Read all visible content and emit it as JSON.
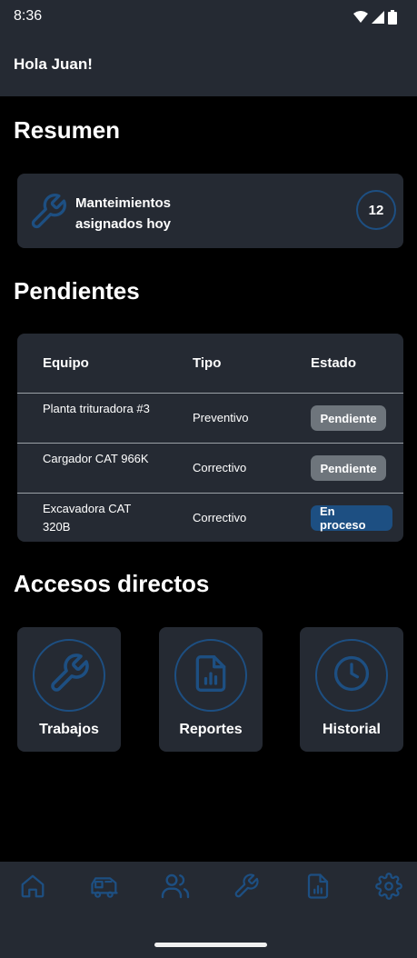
{
  "status_bar": {
    "time": "8:36",
    "icons": [
      "wifi-icon",
      "signal-icon",
      "battery-icon"
    ]
  },
  "app_bar": {
    "greeting": "Hola Juan!"
  },
  "summary": {
    "title": "Resumen",
    "card": {
      "icon": "wrench-icon",
      "label": "Manteimientos asignados hoy",
      "count": "12"
    }
  },
  "pending": {
    "title": "Pendientes",
    "columns": [
      "Equipo",
      "Tipo",
      "Estado"
    ],
    "rows": [
      {
        "equipo": "Planta trituradora #3",
        "tipo": "Preventivo",
        "estado": "Pendiente"
      },
      {
        "equipo": "Cargador CAT 966K",
        "tipo": "Correctivo",
        "estado": "Pendiente"
      },
      {
        "equipo": "Excavadora CAT 320B",
        "tipo": "Correctivo",
        "estado": "En proceso"
      }
    ]
  },
  "shortcuts": {
    "title": "Accesos directos",
    "items": [
      {
        "label": "Trabajos",
        "icon": "wrench-icon"
      },
      {
        "label": "Reportes",
        "icon": "report-file-icon"
      },
      {
        "label": "Historial",
        "icon": "clock-icon"
      }
    ]
  },
  "bottom_nav": {
    "items": [
      "home-icon",
      "truck-icon",
      "users-icon",
      "wrench-icon",
      "report-file-icon",
      "gear-icon"
    ]
  },
  "colors": {
    "background": "#000000",
    "surface": "#252a33",
    "accent": "#1d4f82",
    "badge_pending": "#6e757c",
    "badge_in_progress": "#1d4f82"
  }
}
